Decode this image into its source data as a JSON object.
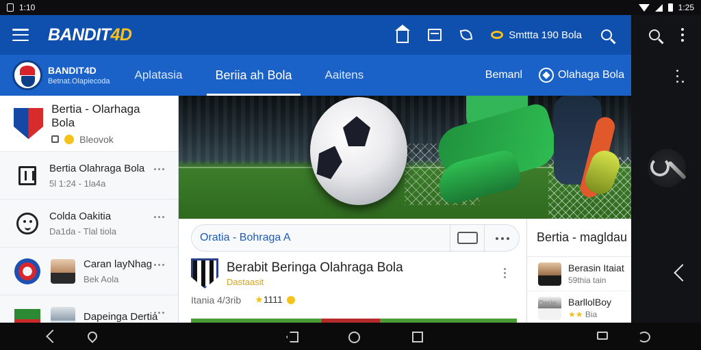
{
  "status_bar": {
    "time_left": "1:10",
    "time_right": "1:25"
  },
  "app_bar": {
    "brand_part1": "BANDIT",
    "brand_part2": "4D",
    "coin_label": "Smttta 190 Bola"
  },
  "tab_bar": {
    "logo_title": "BANDIT4D",
    "logo_subtitle": "Betnat.Olapiecoda",
    "tabs": [
      {
        "label": "Aplatasia"
      },
      {
        "label": "Beriia ah Bola"
      },
      {
        "label": "Aaitens"
      }
    ],
    "right_items": [
      {
        "label": "Bemanl"
      },
      {
        "label": "Olahaga Bola"
      }
    ]
  },
  "sidebar": {
    "header_title": "Bertia - Olarhaga Bola",
    "header_meta": "Bleovok",
    "items": [
      {
        "title": "Bertia Olahraga Bola",
        "subtitle": "5l 1:24 - 1la4a"
      },
      {
        "title": "Colda Oakitia",
        "subtitle": "Da1da - Tlal tiola"
      },
      {
        "title": "Caran layNhag",
        "subtitle": "Bek Aola"
      },
      {
        "title": "Dapeinga Dertia",
        "subtitle": ""
      }
    ]
  },
  "content": {
    "filter_label": "Oratia - Bohraga A",
    "article_title": "Berabit Beringa Olahraga Bola",
    "article_subtitle": "Dastaasit",
    "article_meta_left": "Itania  4/3rib",
    "article_meta_stars": "1111"
  },
  "right_card": {
    "heading": "Bertia - magldau",
    "items": [
      {
        "title": "Berasin Itaiat",
        "subtitle": "59thia tain"
      },
      {
        "title": "BarllolBoy",
        "subtitle": "Bia"
      }
    ],
    "label_top": "Oerie"
  },
  "colors": {
    "primary_blue": "#0f4fae",
    "tab_blue": "#1a62c8",
    "accent_yellow": "#f7c21b"
  }
}
